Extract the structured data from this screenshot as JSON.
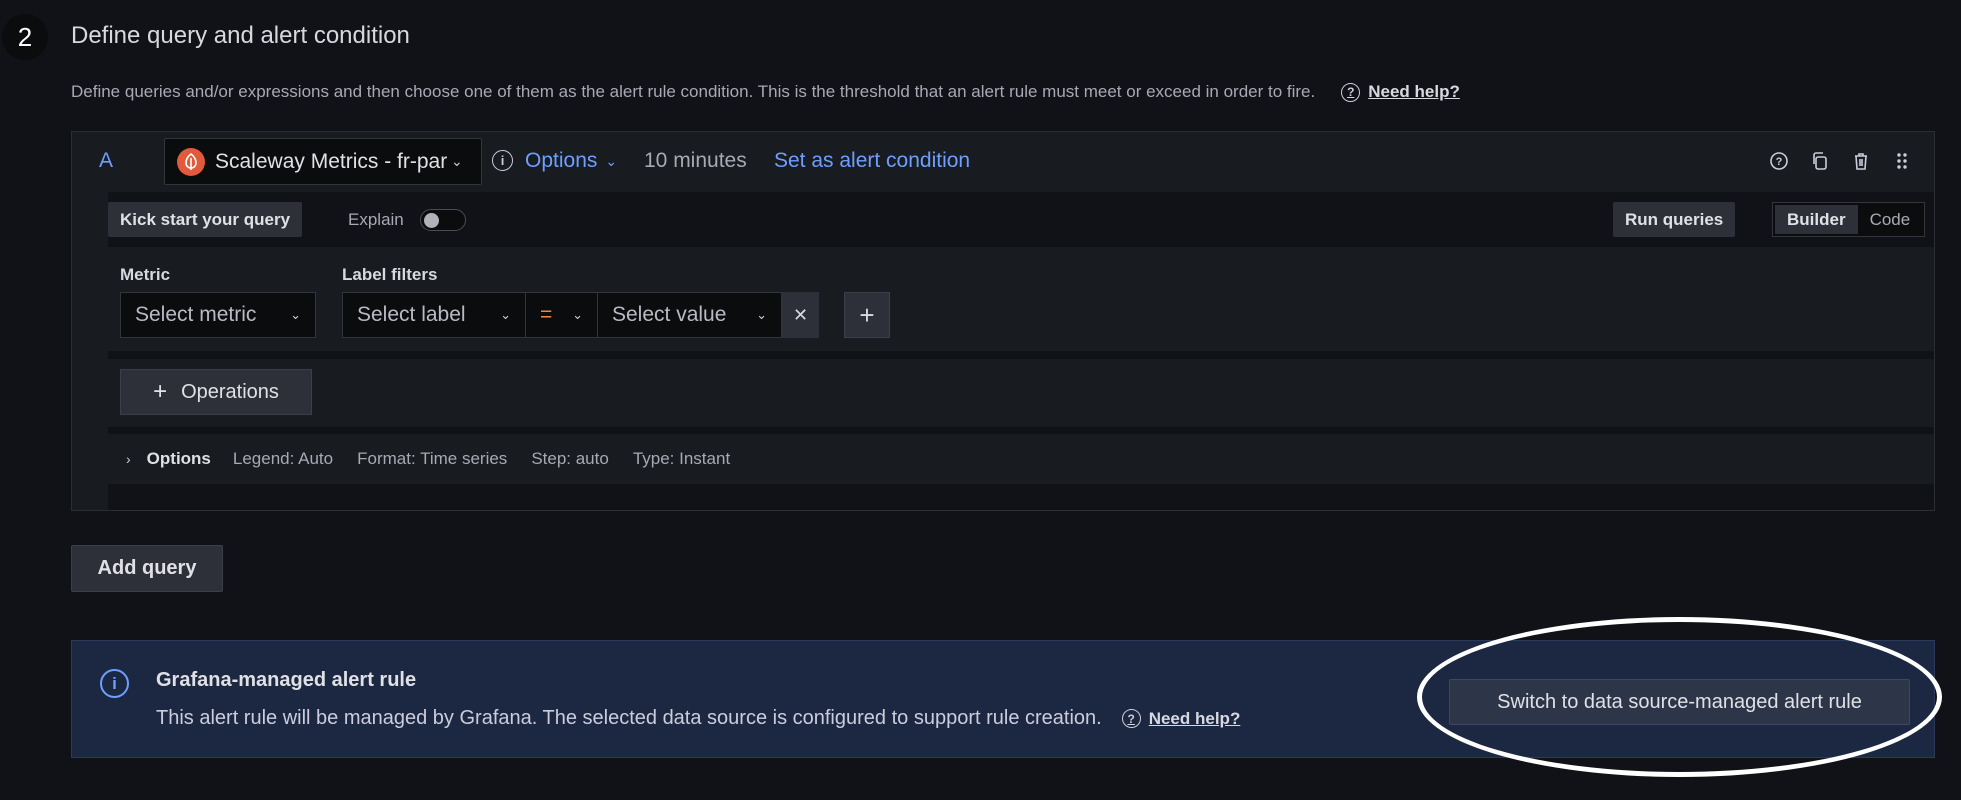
{
  "step": {
    "number": "2",
    "title": "Define query and alert condition"
  },
  "description": {
    "text": "Define queries and/or expressions and then choose one of them as the alert rule condition. This is the threshold that an alert rule must meet or exceed in order to fire.",
    "help_label": "Need help?"
  },
  "query": {
    "ref_id": "A",
    "datasource": "Scaleway Metrics - fr-par",
    "options_label": "Options",
    "interval": "10 minutes",
    "set_condition_label": "Set as alert condition",
    "kick_start_label": "Kick start your query",
    "explain_label": "Explain",
    "run_queries_label": "Run queries",
    "modes": [
      "Builder",
      "Code"
    ],
    "active_mode": "Builder",
    "metric": {
      "label": "Metric",
      "placeholder": "Select metric"
    },
    "label_filters": {
      "label": "Label filters",
      "label_placeholder": "Select label",
      "operator": "=",
      "value_placeholder": "Select value"
    },
    "operations_label": "Operations",
    "options_row": {
      "title": "Options",
      "legend": "Legend: Auto",
      "format": "Format: Time series",
      "step": "Step: auto",
      "type": "Type: Instant"
    }
  },
  "add_query_label": "Add query",
  "alert": {
    "title": "Grafana-managed alert rule",
    "text": "This alert rule will be managed by Grafana. The selected data source is configured to support rule creation.",
    "help_label": "Need help?",
    "switch_label": "Switch to data source-managed alert rule"
  },
  "colors": {
    "accent_blue": "#6e9fff",
    "operator_orange": "#f5893b",
    "datasource_logo": "#e05a3b"
  }
}
